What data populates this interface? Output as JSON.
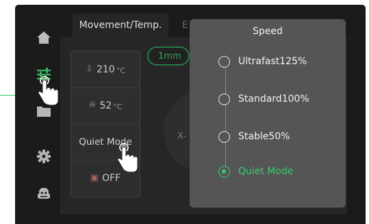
{
  "tabs": [
    {
      "label": "Movement/Temp."
    },
    {
      "label": "E"
    }
  ],
  "params": {
    "nozzle_temp": "210",
    "bed_temp": "52",
    "temp_unit": "°C",
    "speed_mode": "Quiet Mode",
    "fan": "OFF"
  },
  "step": {
    "label": "1mm"
  },
  "axis": {
    "x_label": "X-"
  },
  "speed_panel": {
    "title": "Speed",
    "options": [
      {
        "label": "Ultrafast125%",
        "selected": false
      },
      {
        "label": "Standard100%",
        "selected": false
      },
      {
        "label": "Stable50%",
        "selected": false
      },
      {
        "label": "Quiet Mode",
        "selected": true
      }
    ]
  },
  "colors": {
    "accent": "#3dcc6e",
    "leader_line": "#27c36a"
  },
  "icons": [
    "home-icon",
    "sliders-icon",
    "folder-icon",
    "gear-icon",
    "robot-icon",
    "nozzle-icon",
    "bed-icon",
    "fan-icon",
    "hand-pointer-icon"
  ]
}
